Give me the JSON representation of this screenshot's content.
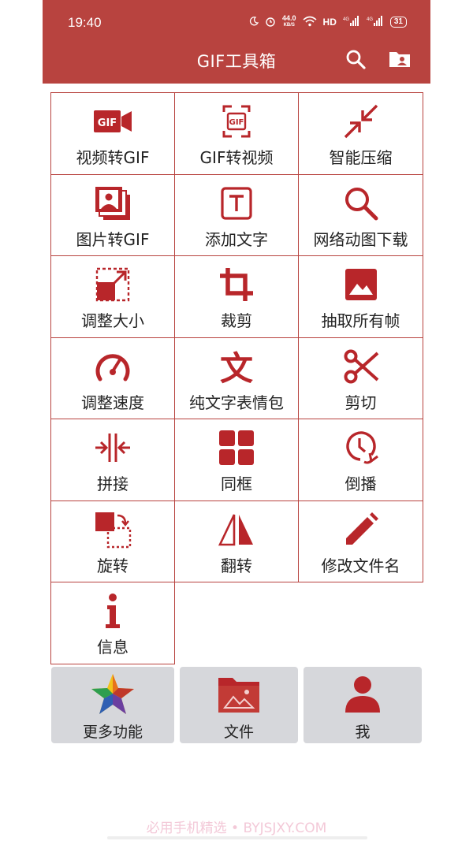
{
  "status_bar": {
    "time": "19:40",
    "net_speed_value": "44.0",
    "net_speed_unit": "KB/S",
    "hd": "HD",
    "battery": "31"
  },
  "header": {
    "title": "GIF工具箱",
    "search_icon": "search-icon",
    "folder_icon": "folder-user-icon"
  },
  "accent_color": "#b8433f",
  "tools": [
    {
      "id": "video-to-gif",
      "label": "视频转GIF",
      "icon": "gif-camera-icon"
    },
    {
      "id": "gif-to-video",
      "label": "GIF转视频",
      "icon": "gif-frame-icon"
    },
    {
      "id": "smart-compress",
      "label": "智能压缩",
      "icon": "compress-arrows-icon"
    },
    {
      "id": "image-to-gif",
      "label": "图片转GIF",
      "icon": "photo-stack-icon"
    },
    {
      "id": "add-text",
      "label": "添加文字",
      "icon": "text-box-icon"
    },
    {
      "id": "download-gif",
      "label": "网络动图下载",
      "icon": "search-icon"
    },
    {
      "id": "resize",
      "label": "调整大小",
      "icon": "resize-icon"
    },
    {
      "id": "crop",
      "label": "裁剪",
      "icon": "crop-icon"
    },
    {
      "id": "extract-frames",
      "label": "抽取所有帧",
      "icon": "image-icon"
    },
    {
      "id": "speed",
      "label": "调整速度",
      "icon": "speedometer-icon"
    },
    {
      "id": "text-emoji",
      "label": "纯文字表情包",
      "icon": "wen-character-icon"
    },
    {
      "id": "cut",
      "label": "剪切",
      "icon": "scissors-icon"
    },
    {
      "id": "splice",
      "label": "拼接",
      "icon": "merge-icon"
    },
    {
      "id": "same-frame",
      "label": "同框",
      "icon": "grid-icon"
    },
    {
      "id": "reverse",
      "label": "倒播",
      "icon": "reverse-clock-icon"
    },
    {
      "id": "rotate",
      "label": "旋转",
      "icon": "rotate-icon"
    },
    {
      "id": "flip",
      "label": "翻转",
      "icon": "flip-icon"
    },
    {
      "id": "rename",
      "label": "修改文件名",
      "icon": "pencil-icon"
    },
    {
      "id": "info",
      "label": "信息",
      "icon": "info-icon"
    }
  ],
  "bottom_tabs": [
    {
      "id": "more",
      "label": "更多功能",
      "icon": "star-icon"
    },
    {
      "id": "files",
      "label": "文件",
      "icon": "folder-image-icon"
    },
    {
      "id": "me",
      "label": "我",
      "icon": "person-icon"
    }
  ],
  "watermark": "必用手机精选 • BYJSJXY.COM"
}
